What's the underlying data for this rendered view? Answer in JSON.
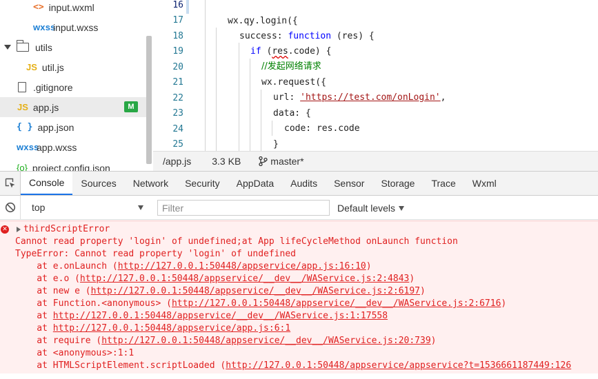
{
  "explorer": {
    "items": [
      {
        "label": "input.wxml",
        "icon": "html-file-icon",
        "glyph": "<>"
      },
      {
        "label": "input.wxss",
        "icon": "wxss-file-icon",
        "glyph": "wxss"
      },
      {
        "label": "utils",
        "icon": "folder-icon"
      },
      {
        "label": "util.js",
        "icon": "js-file-icon",
        "glyph": "JS"
      },
      {
        "label": ".gitignore",
        "icon": "file-icon"
      },
      {
        "label": "app.js",
        "icon": "js-file-icon",
        "glyph": "JS",
        "badge": "M",
        "selected": true
      },
      {
        "label": "app.json",
        "icon": "json-file-icon",
        "glyph": "{ }"
      },
      {
        "label": "app.wxss",
        "icon": "wxss-file-icon",
        "glyph": "wxss"
      },
      {
        "label": "project.config.json",
        "icon": "gear-icon",
        "glyph": "{o}"
      }
    ]
  },
  "editor": {
    "line_numbers": [
      "16",
      "17",
      "18",
      "19",
      "20",
      "21",
      "22",
      "23",
      "24",
      "25"
    ],
    "code": {
      "l17": "wx.qy.login({",
      "l18_a": "success: ",
      "l18_kw": "function",
      "l18_b": " (res) {",
      "l19_kw": "if",
      "l19_a": " (",
      "l19_res": "res",
      "l19_b": ".code) {",
      "l20_cmt": "//发起网络请求",
      "l21": "wx.request({",
      "l22_a": "url: ",
      "l22_str": "'https://test.com/onLogin'",
      "l22_b": ",",
      "l23": "data: {",
      "l24": "code: res.code",
      "l25": "}"
    }
  },
  "statusbar": {
    "file": "/app.js",
    "size": "3.3 KB",
    "branch": "master*"
  },
  "devtools": {
    "tabs": [
      "Console",
      "Sources",
      "Network",
      "Security",
      "AppData",
      "Audits",
      "Sensor",
      "Storage",
      "Trace",
      "Wxml"
    ],
    "active_tab": "Console"
  },
  "console": {
    "context": "top",
    "filter_placeholder": "Filter",
    "levels": "Default levels",
    "error_title": "thirdScriptError",
    "lines": [
      {
        "text": "Cannot read property 'login' of undefined;at App lifeCycleMethod onLaunch function"
      },
      {
        "text": "TypeError: Cannot read property 'login' of undefined"
      },
      {
        "pre": "    at e.onLaunch (",
        "link": "http://127.0.0.1:50448/appservice/app.js:16:10",
        "post": ")"
      },
      {
        "pre": "    at e.o (",
        "link": "http://127.0.0.1:50448/appservice/__dev__/WAService.js:2:4843",
        "post": ")"
      },
      {
        "pre": "    at new e (",
        "link": "http://127.0.0.1:50448/appservice/__dev__/WAService.js:2:6197",
        "post": ")"
      },
      {
        "pre": "    at Function.<anonymous> (",
        "link": "http://127.0.0.1:50448/appservice/__dev__/WAService.js:2:6716",
        "post": ")"
      },
      {
        "pre": "    at ",
        "link": "http://127.0.0.1:50448/appservice/__dev__/WAService.js:1:17558",
        "post": ""
      },
      {
        "pre": "    at ",
        "link": "http://127.0.0.1:50448/appservice/app.js:6:1",
        "post": ""
      },
      {
        "pre": "    at require (",
        "link": "http://127.0.0.1:50448/appservice/__dev__/WAService.js:20:739",
        "post": ")"
      },
      {
        "pre": "    at <anonymous>:1:1",
        "link": "",
        "post": ""
      },
      {
        "pre": "    at HTMLScriptElement.scriptLoaded (",
        "link": "http://127.0.0.1:50448/appservice/appservice?t=1536661187449:126",
        "post": ""
      }
    ]
  },
  "colors": {
    "error_text": "#e02020",
    "error_bg": "#fff0f0",
    "modified_badge": "#28a745",
    "active_tab_underline": "#1a73e8"
  }
}
